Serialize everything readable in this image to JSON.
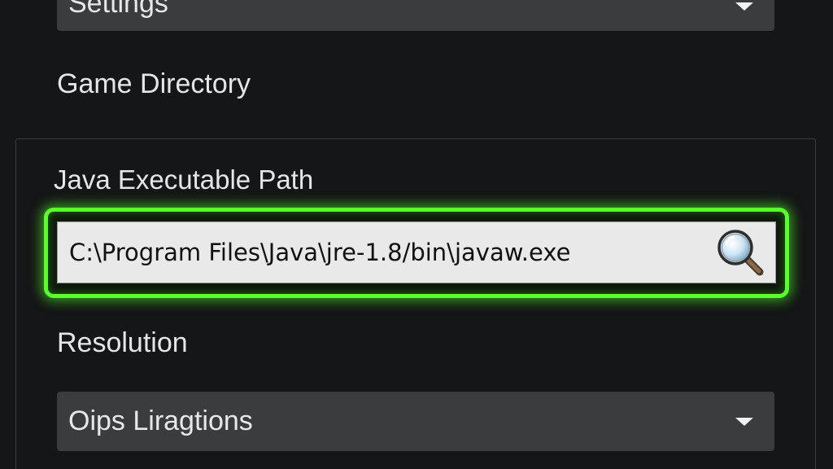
{
  "top_dropdown": {
    "value": "Settings"
  },
  "game_directory": {
    "label": "Game Directory"
  },
  "java": {
    "label": "Java Executable Path",
    "path_value": "C:\\Program Files\\Java\\jre-1.8/bin\\javaw.exe",
    "highlight_color": "#5bff2e"
  },
  "resolution": {
    "label": "Resolution",
    "dropdown_value": "Oips Liragtions"
  },
  "icons": {
    "search": "magnifier-icon",
    "caret": "chevron-down-icon"
  }
}
